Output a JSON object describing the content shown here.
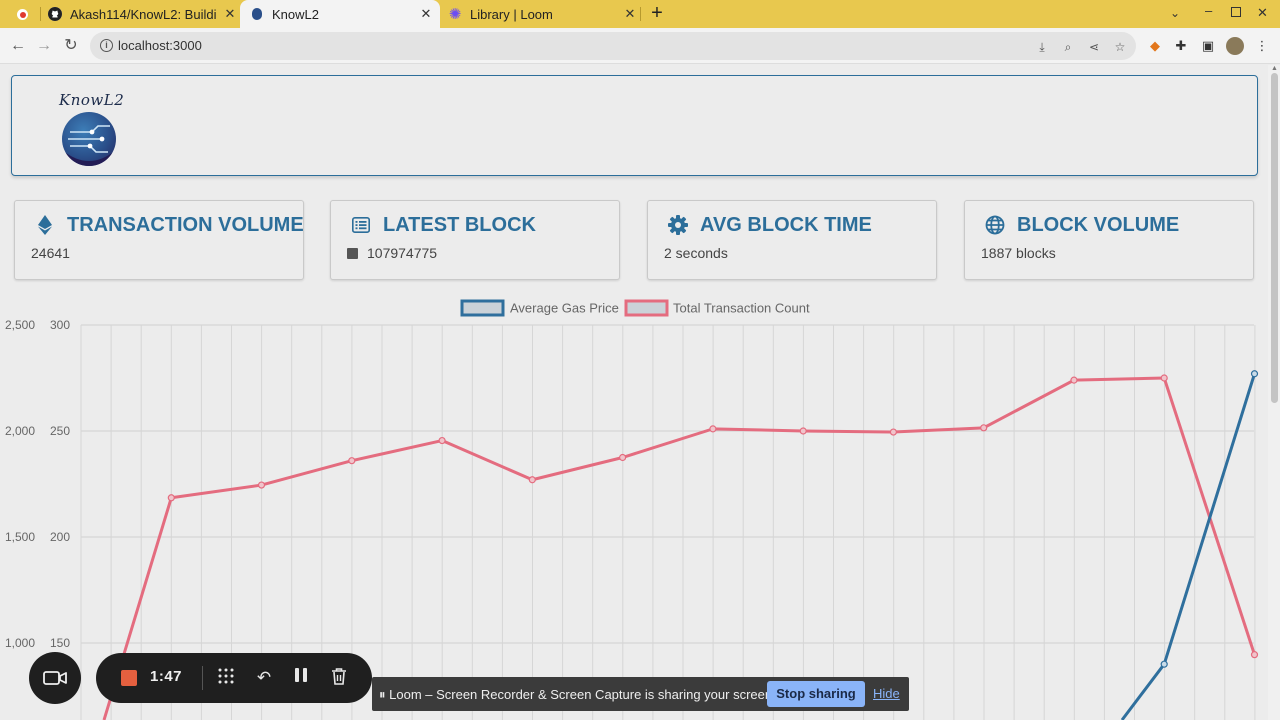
{
  "browser": {
    "tabs": [
      {
        "title": "Akash114/KnowL2: Buildi",
        "favicon": "github-icon"
      },
      {
        "title": "KnowL2",
        "favicon": "knowl2-icon",
        "active": true
      },
      {
        "title": "Library | Loom",
        "favicon": "loom-icon"
      }
    ],
    "url": "localhost:3000"
  },
  "header": {
    "logo_text": "KnowL2"
  },
  "cards": [
    {
      "title": "TRANSACTION VOLUME",
      "value": "24641",
      "icon": "ethereum-icon"
    },
    {
      "title": "LATEST BLOCK",
      "value": "107974775",
      "icon": "list-icon"
    },
    {
      "title": "AVG BLOCK TIME",
      "value": "2 seconds",
      "icon": "gear-icon"
    },
    {
      "title": "BLOCK VOLUME",
      "value": "1887 blocks",
      "icon": "globe-icon"
    }
  ],
  "chart_data": {
    "type": "line",
    "series": [
      {
        "name": "Average Gas Price",
        "color": "#2f6f9d",
        "values": [
          null,
          null,
          null,
          null,
          null,
          null,
          null,
          null,
          null,
          null,
          null,
          null,
          105,
          140,
          277
        ]
      },
      {
        "name": "Total Transaction Count",
        "color": "#e46c7f",
        "values": [
          720,
          1685,
          1745,
          1860,
          1955,
          1770,
          1875,
          2010,
          2000,
          1995,
          2015,
          2240,
          2250,
          945
        ]
      }
    ],
    "y_left": {
      "ticks": [
        "2,500",
        "2,000",
        "1,500",
        "1,000"
      ],
      "range": [
        1000,
        2500
      ]
    },
    "y_right": {
      "ticks": [
        "300",
        "250",
        "200",
        "150"
      ],
      "range": [
        150,
        300
      ]
    },
    "legend": "top-center",
    "grid": true
  },
  "loom": {
    "timer": "1:47",
    "share_message": "Loom – Screen Recorder & Screen Capture is sharing your screen.",
    "stop_label": "Stop sharing",
    "hide_label": "Hide",
    "pause_glyph": "⏸"
  }
}
